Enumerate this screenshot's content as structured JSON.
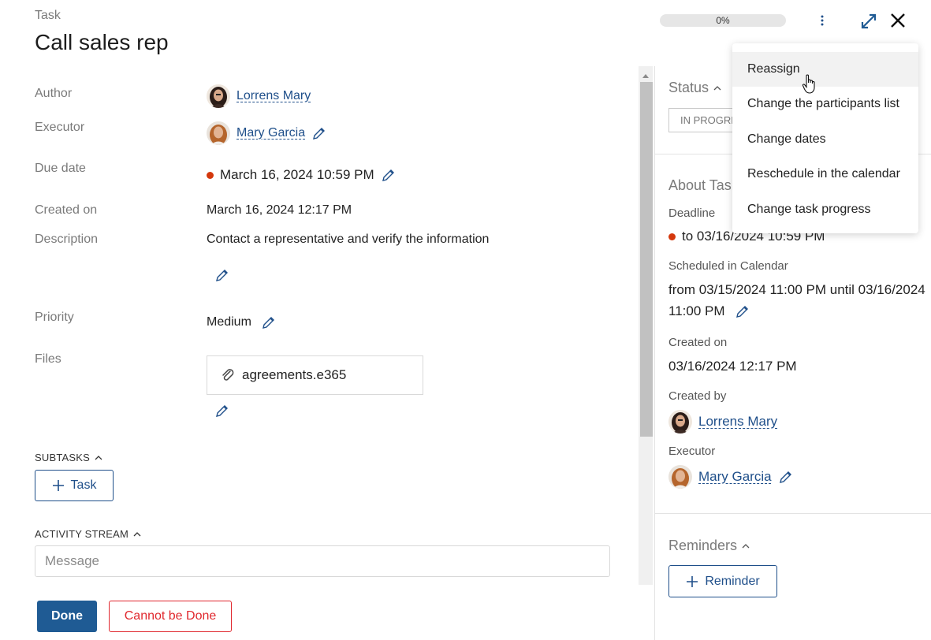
{
  "header": {
    "type_label": "Task",
    "title": "Call sales rep",
    "progress_text": "0%",
    "progress_value": 0
  },
  "fields": {
    "author": {
      "label": "Author",
      "value": "Lorrens Mary"
    },
    "executor": {
      "label": "Executor",
      "value": "Mary Garcia"
    },
    "due_date": {
      "label": "Due date",
      "value": "March 16, 2024 10:59 PM",
      "status_color": "#d4380d"
    },
    "created_on": {
      "label": "Created on",
      "value": "March 16, 2024 12:17 PM"
    },
    "description": {
      "label": "Description",
      "value": "Contact a representative and verify the information"
    },
    "priority": {
      "label": "Priority",
      "value": "Medium"
    },
    "files": {
      "label": "Files",
      "file_name": "agreements.e365"
    }
  },
  "subtasks": {
    "heading": "SUBTASKS",
    "add_label": "Task"
  },
  "activity": {
    "heading": "ACTIVITY STREAM",
    "placeholder": "Message"
  },
  "actions": {
    "done_label": "Done",
    "cannot_label": "Cannot be Done"
  },
  "right_panel": {
    "status": {
      "heading": "Status",
      "badge": "IN PROGRESS"
    },
    "about": {
      "heading": "About Task",
      "deadline_label": "Deadline",
      "deadline_value": "to 03/16/2024 10:59 PM",
      "scheduled_label": "Scheduled in Calendar",
      "scheduled_line1": "from 03/15/2024 11:00 PM until 03/16/2024",
      "scheduled_line2": "11:00 PM",
      "created_on_label": "Created on",
      "created_on_value": "03/16/2024 12:17 PM",
      "created_by_label": "Created by",
      "created_by_value": "Lorrens Mary",
      "executor_label": "Executor",
      "executor_value": "Mary Garcia"
    },
    "reminders": {
      "heading": "Reminders",
      "add_label": "Reminder"
    }
  },
  "menu": {
    "items": [
      {
        "label": "Reassign",
        "hovered": true
      },
      {
        "label": "Change the participants list"
      },
      {
        "label": "Change dates"
      },
      {
        "label": "Reschedule in the calendar"
      },
      {
        "label": "Change task progress"
      }
    ]
  },
  "colors": {
    "link": "#1f4f8a",
    "primary": "#1f5b94",
    "danger": "#e0282e",
    "overdue_dot": "#d4380d"
  }
}
